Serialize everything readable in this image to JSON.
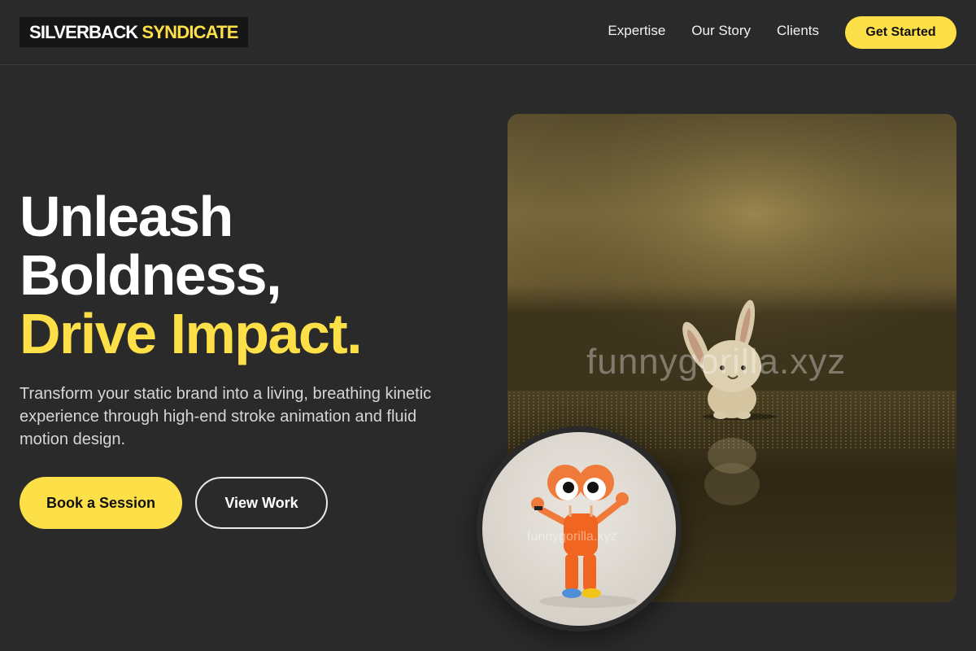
{
  "brand": {
    "part1": "SILVERBACK",
    "part2": "SYNDICATE"
  },
  "nav": {
    "items": [
      "Expertise",
      "Our Story",
      "Clients"
    ],
    "cta": "Get Started"
  },
  "hero": {
    "line1": "Unleash",
    "line2": "Boldness,",
    "line3": "Drive Impact.",
    "lead": "Transform your static brand into a living, breathing kinetic experience through high-end stroke animation and fluid motion design.",
    "primary_button": "Book a Session",
    "secondary_button": "View Work"
  },
  "images": {
    "main_watermark": "funnygorilla.xyz",
    "circle_watermark": "funnygorilla.xyz"
  },
  "colors": {
    "accent": "#fde047",
    "background": "#2a2a2a"
  }
}
